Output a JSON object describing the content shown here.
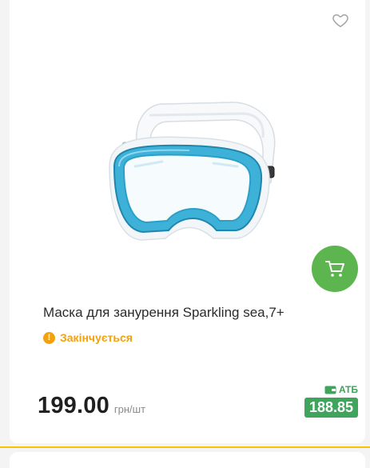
{
  "product": {
    "title": "Маска для занурення Sparkling sea,7+",
    "status": "Закінчується",
    "price": "199.00",
    "unit": "грн/шт",
    "promo_label": "АТБ",
    "promo_price": "188.85"
  },
  "icons": {
    "favorite": "heart-icon",
    "cart": "cart-icon",
    "status": "exclamation-icon",
    "wallet": "wallet-icon"
  },
  "colors": {
    "cart_button": "#5db54f",
    "status": "#f3a20a",
    "promo": "#3fa45c",
    "divider": "#f6c400"
  }
}
